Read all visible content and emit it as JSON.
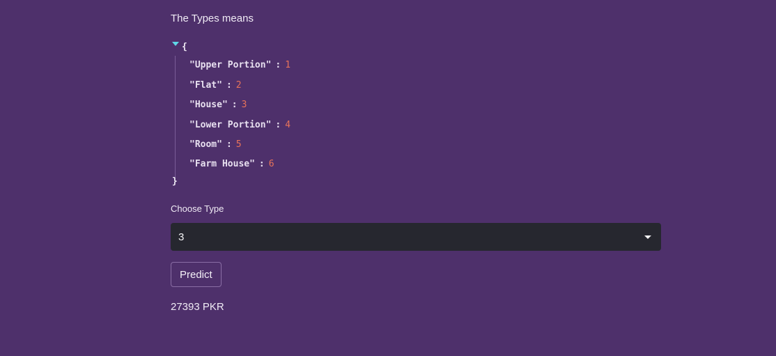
{
  "heading": "The Types means",
  "json_view": {
    "open_brace": "{",
    "close_brace": "}",
    "colon": ":",
    "entries": [
      {
        "key": "\"Upper Portion\"",
        "value": "1"
      },
      {
        "key": "\"Flat\"",
        "value": "2"
      },
      {
        "key": "\"House\"",
        "value": "3"
      },
      {
        "key": "\"Lower Portion\"",
        "value": "4"
      },
      {
        "key": "\"Room\"",
        "value": "5"
      },
      {
        "key": "\"Farm House\"",
        "value": "6"
      }
    ]
  },
  "select": {
    "label": "Choose Type",
    "selected": "3"
  },
  "predict_button": "Predict",
  "result": "27393 PKR",
  "colors": {
    "background": "#4e306b",
    "select_bg": "#26272f",
    "json_number": "#e8735a",
    "toggle": "#5fd7e6"
  }
}
